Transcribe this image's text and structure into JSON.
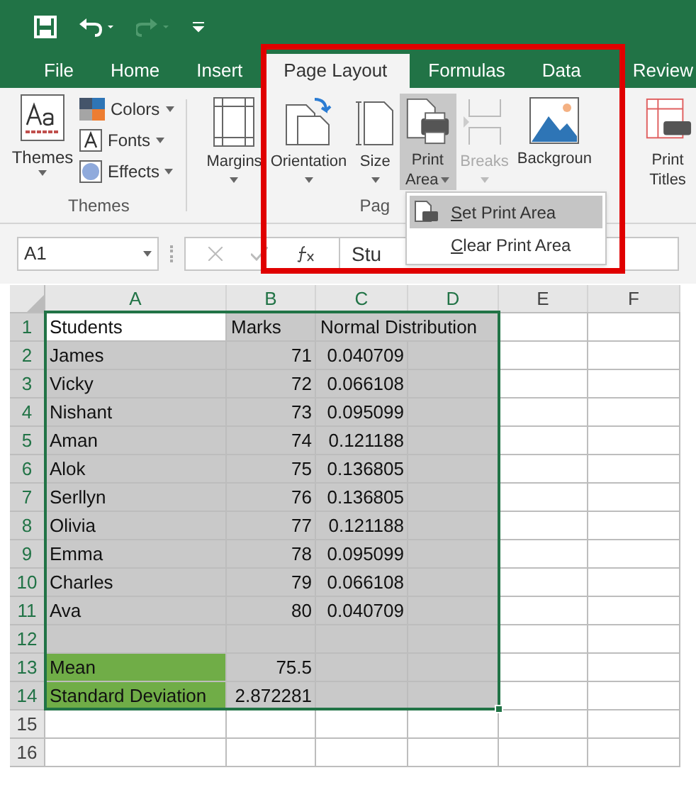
{
  "quick_access": {
    "redo_disabled": true
  },
  "tabs": [
    {
      "label": "File",
      "selected": false
    },
    {
      "label": "Home",
      "selected": false
    },
    {
      "label": "Insert",
      "selected": false
    },
    {
      "label": "Page Layout",
      "selected": true
    },
    {
      "label": "Formulas",
      "selected": false
    },
    {
      "label": "Data",
      "selected": false
    },
    {
      "label": "Review",
      "selected": false
    }
  ],
  "ribbon": {
    "themes": {
      "label": "Themes",
      "small": [
        {
          "label": "Colors",
          "kind": "colors"
        },
        {
          "label": "Fonts",
          "kind": "fonts"
        },
        {
          "label": "Effects",
          "kind": "effects"
        }
      ],
      "group_label": "Themes"
    },
    "page_setup": [
      {
        "label": "Margins",
        "kind": "margins",
        "selected": false,
        "disabled": false,
        "menu": true
      },
      {
        "label": "Orientation",
        "kind": "orientation",
        "selected": false,
        "disabled": false,
        "menu": true
      },
      {
        "label": "Size",
        "kind": "size",
        "selected": false,
        "disabled": false,
        "menu": true
      },
      {
        "label": "Print",
        "label2": "Area",
        "kind": "print-area",
        "selected": true,
        "disabled": false,
        "menu": true
      },
      {
        "label": "Breaks",
        "kind": "breaks",
        "selected": false,
        "disabled": true,
        "menu": true
      },
      {
        "label": "Backgroun",
        "kind": "background",
        "selected": false,
        "disabled": false,
        "menu": false
      },
      {
        "label": "Print",
        "label2": "Titles",
        "kind": "print-titles",
        "selected": false,
        "disabled": false,
        "menu": false
      }
    ],
    "group_label": "Pag"
  },
  "dropdown": [
    {
      "label": "Set Print Area",
      "selected": true
    },
    {
      "label": "Clear Print Area",
      "selected": false
    }
  ],
  "formula_bar": {
    "name_box": "A1",
    "content": "Stu"
  },
  "sheet": {
    "columns": [
      {
        "label": "A",
        "selected": true
      },
      {
        "label": "B",
        "selected": true
      },
      {
        "label": "C",
        "selected": true
      },
      {
        "label": "D",
        "selected": true
      },
      {
        "label": "E",
        "selected": false
      },
      {
        "label": "F",
        "selected": false
      }
    ],
    "rows": [
      {
        "number": "1",
        "selected": true,
        "active": true,
        "kind": "header",
        "cells": [
          "Students",
          "Marks",
          "Normal Distribution"
        ]
      },
      {
        "number": "2",
        "selected": true,
        "cells": [
          "James",
          "71",
          "0.040709"
        ]
      },
      {
        "number": "3",
        "selected": true,
        "cells": [
          "Vicky",
          "72",
          "0.066108"
        ]
      },
      {
        "number": "4",
        "selected": true,
        "cells": [
          "Nishant",
          "73",
          "0.095099"
        ]
      },
      {
        "number": "5",
        "selected": true,
        "cells": [
          "Aman",
          "74",
          "0.121188"
        ]
      },
      {
        "number": "6",
        "selected": true,
        "cells": [
          "Alok",
          "75",
          "0.136805"
        ]
      },
      {
        "number": "7",
        "selected": true,
        "cells": [
          "Serllyn",
          "76",
          "0.136805"
        ]
      },
      {
        "number": "8",
        "selected": true,
        "cells": [
          "Olivia",
          "77",
          "0.121188"
        ]
      },
      {
        "number": "9",
        "selected": true,
        "cells": [
          "Emma",
          "78",
          "0.095099"
        ]
      },
      {
        "number": "10",
        "selected": true,
        "cells": [
          "Charles",
          "79",
          "0.066108"
        ]
      },
      {
        "number": "11",
        "selected": true,
        "cells": [
          "Ava",
          "80",
          "0.040709"
        ]
      },
      {
        "number": "12",
        "selected": true
      },
      {
        "number": "13",
        "selected": true,
        "color": "#70ad47",
        "cells": [
          "Mean",
          "75.5"
        ]
      },
      {
        "number": "14",
        "selected": true,
        "color": "#70ad47",
        "cells": [
          "Standard Deviation",
          "2.872281"
        ]
      },
      {
        "number": "15",
        "selected": false
      },
      {
        "number": "16",
        "selected": false
      }
    ]
  }
}
